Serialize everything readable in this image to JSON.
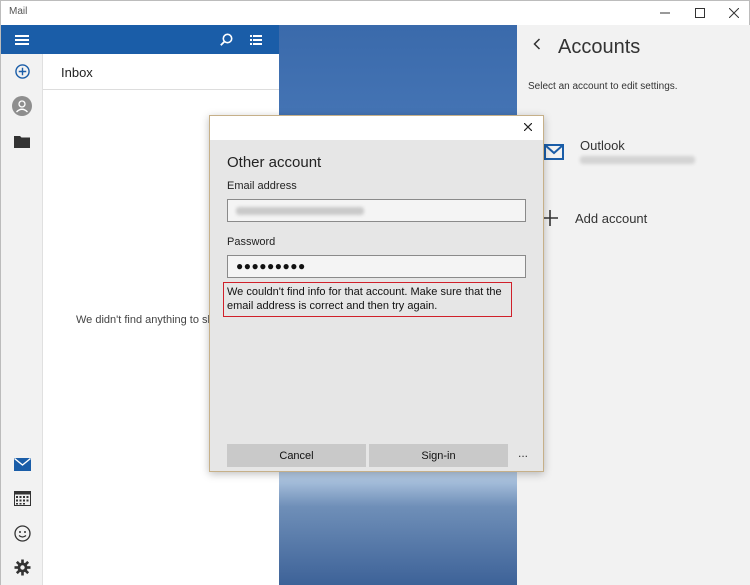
{
  "window": {
    "title": "Mail"
  },
  "list": {
    "folder_name": "Inbox",
    "empty_message": "We didn't find anything to sho"
  },
  "accounts": {
    "title": "Accounts",
    "hint": "Select an account to edit settings.",
    "account_name": "Outlook",
    "add_label": "Add account"
  },
  "dialog": {
    "title": "Other account",
    "email_label": "Email address",
    "password_label": "Password",
    "password_mask": "●●●●●●●●●",
    "error_text": "We couldn't find info for that account. Make sure that the email address is correct and then try again.",
    "cancel_label": "Cancel",
    "signin_label": "Sign-in",
    "more_label": "..."
  },
  "colors": {
    "accent": "#1a5da8",
    "error_border": "#d0202a",
    "dialog_border": "#c6b089"
  },
  "icons": [
    "hamburger-icon",
    "compose-icon",
    "avatar-icon",
    "folder-icon",
    "search-icon",
    "list-filter-icon",
    "back-icon",
    "mail-icon",
    "add-icon",
    "calendar-icon",
    "feedback-icon",
    "settings-icon",
    "close-icon",
    "minimize-icon",
    "maximize-icon"
  ]
}
